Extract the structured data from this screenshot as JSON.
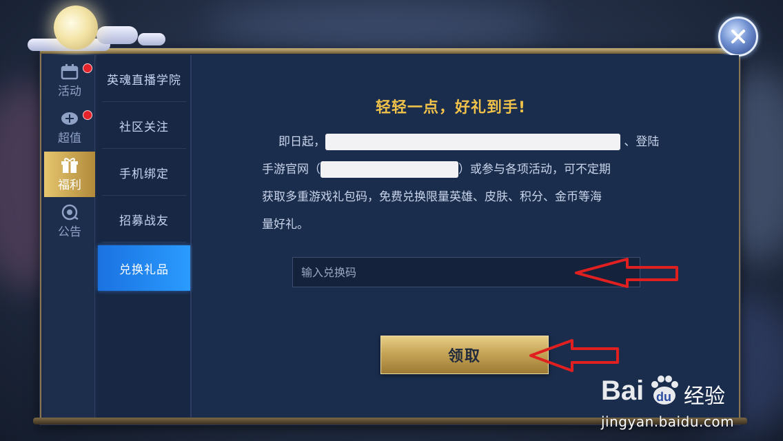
{
  "categories": [
    {
      "label": "活动",
      "badge": true
    },
    {
      "label": "超值",
      "badge": true
    },
    {
      "label": "福利",
      "badge": false,
      "active": true
    },
    {
      "label": "公告",
      "badge": false
    }
  ],
  "submenu": [
    {
      "label": "英魂直播学院"
    },
    {
      "label": "社区关注"
    },
    {
      "label": "手机绑定"
    },
    {
      "label": "招募战友"
    },
    {
      "label": "兑换礼品",
      "active": true
    }
  ],
  "content": {
    "title": "轻轻一点，好礼到手!",
    "line1_start": "即日起，",
    "line1_end": "、登陆",
    "line2_start": "手游官网（",
    "line2_end": "）或参与各项活动，可不定期",
    "line3": "获取多重游戏礼包码，免费兑换限量英雄、皮肤、积分、金币等海",
    "line4": "量好礼。"
  },
  "redeem": {
    "placeholder": "输入兑换码",
    "button_label": "领取"
  },
  "watermark": {
    "brand": "Baidu经验",
    "url": "jingyan.baidu.com"
  },
  "colors": {
    "accent_gold": "#f0c24a",
    "active_tab_blue": "#1a72e0",
    "arrow_red": "#e02020"
  }
}
